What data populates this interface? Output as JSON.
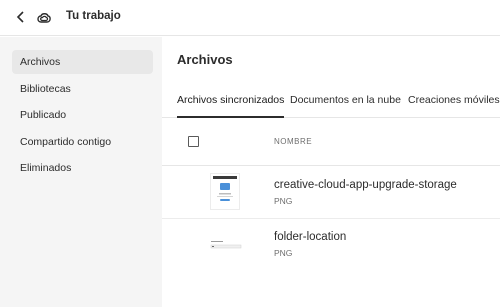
{
  "header": {
    "title": "Tu trabajo"
  },
  "sidebar": {
    "items": [
      {
        "label": "Archivos",
        "active": true
      },
      {
        "label": "Bibliotecas"
      },
      {
        "label": "Publicado"
      },
      {
        "label": "Compartido contigo"
      },
      {
        "label": "Eliminados"
      }
    ]
  },
  "main": {
    "title": "Archivos",
    "tabs": [
      {
        "label": "Archivos sincronizados",
        "active": true
      },
      {
        "label": "Documentos en la nube"
      },
      {
        "label": "Creaciones móviles"
      }
    ],
    "column_header": "NOMBRE",
    "files": [
      {
        "name": "creative-cloud-app-upgrade-storage",
        "type": "PNG"
      },
      {
        "name": "folder-location",
        "type": "PNG"
      }
    ]
  },
  "colors": {
    "accent": "#2c2c2c",
    "sidebar_bg": "#f5f5f5",
    "active_bg": "#e8e8e8"
  },
  "icons": [
    "chevron-left-icon",
    "creative-cloud-logo"
  ]
}
